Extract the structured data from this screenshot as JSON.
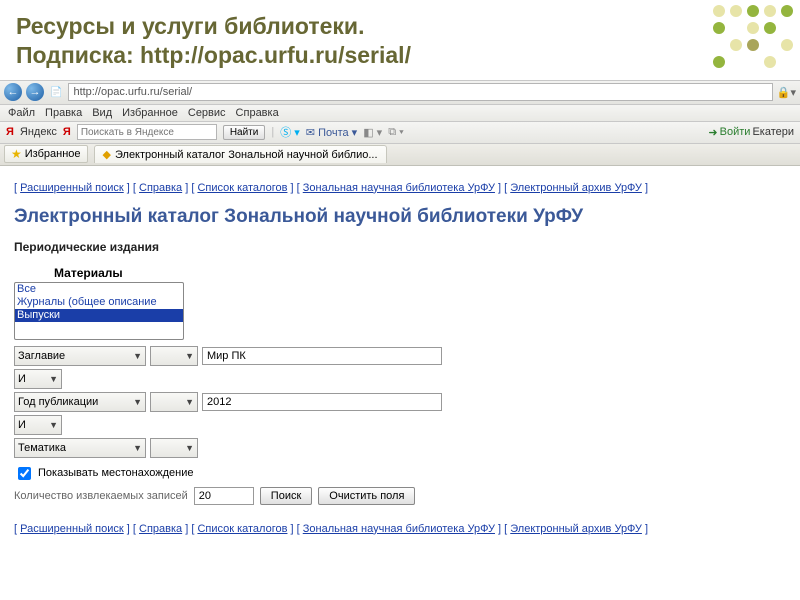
{
  "slide": {
    "title_line1": "Ресурсы и услуги библиотеки.",
    "title_line2": "Подписка: http://opac.urfu.ru/serial/"
  },
  "browser": {
    "url": "http://opac.urfu.ru/serial/",
    "menu": {
      "file": "Файл",
      "edit": "Правка",
      "view": "Вид",
      "fav": "Избранное",
      "tools": "Сервис",
      "help": "Справка"
    },
    "yandex": {
      "brand": "Яндекс",
      "placeholder": "Поискать в Яндексе",
      "search_btn": "Найти",
      "mail": "Почта",
      "login_btn": "Войти",
      "user": "Екатери"
    },
    "tabs": {
      "fav": "Избранное",
      "current": "Электронный каталог Зональной научной библио..."
    }
  },
  "links": {
    "l1": "Расширенный поиск",
    "l2": "Справка",
    "l3": "Список каталогов",
    "l4": "Зональная научная библиотека УрФУ",
    "l5": "Электронный архив УрФУ"
  },
  "page": {
    "h1": "Электронный каталог Зональной научной библиотеки УрФУ",
    "sub": "Периодические издания",
    "materials_label": "Материалы",
    "materials": {
      "o1": "Все",
      "o2": "Журналы (общее описание",
      "o3": "Выпуски"
    },
    "fields": {
      "title": "Заглавие",
      "and": "И",
      "year": "Год публикации",
      "subject": "Тематика",
      "val_title": "Мир ПК",
      "val_year": "2012"
    },
    "show_loc": "Показывать местонахождение",
    "count_label": "Количество извлекаемых записей",
    "count_value": "20",
    "search_btn": "Поиск",
    "clear_btn": "Очистить поля"
  }
}
